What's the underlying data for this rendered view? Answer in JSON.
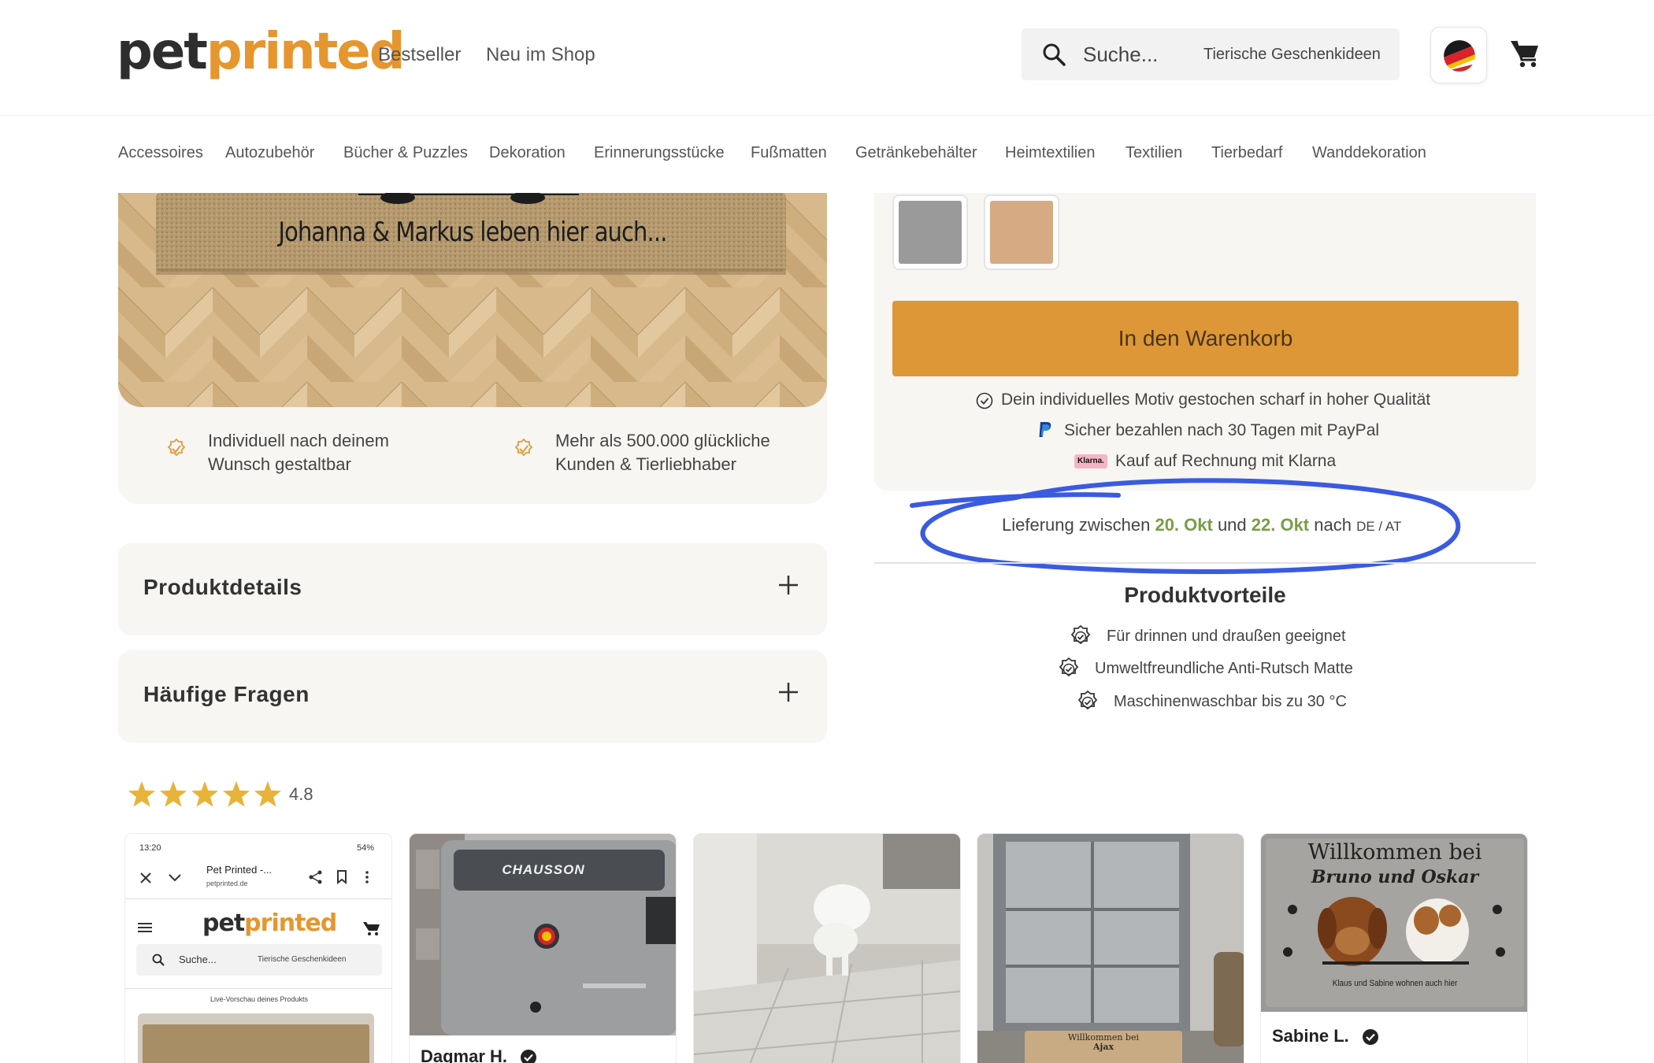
{
  "header": {
    "logo_part1": "pet",
    "logo_part2": "printed",
    "nav": [
      "Bestseller",
      "Neu im Shop"
    ],
    "search": {
      "placeholder": "Suche...",
      "hint": "Tierische Geschenkideen"
    },
    "flag_icon": "germany-austria-flag-icon",
    "cart_icon": "shopping-cart-icon"
  },
  "categories": [
    "Accessoires",
    "Autozubehör",
    "Bücher & Puzzles",
    "Dekoration",
    "Erinnerungsstücke",
    "Fußmatten",
    "Getränkebehälter",
    "Heimtextilien",
    "Textilien",
    "Tierbedarf",
    "Wanddekoration"
  ],
  "product": {
    "mat_text": "Johanna & Markus leben hier auch...",
    "benefits": [
      {
        "line1": "Individuell nach deinem",
        "line2": "Wunsch gestaltbar"
      },
      {
        "line1": "Mehr als 500.000 glückliche",
        "line2": "Kunden & Tierliebhaber"
      }
    ],
    "accordions": [
      "Produktdetails",
      "Häufige Fragen"
    ]
  },
  "purchase": {
    "swatches": [
      {
        "name": "grau",
        "color": "#9a9a9a"
      },
      {
        "name": "natur",
        "color": "#d6aa82"
      }
    ],
    "cart_button": "In den Warenkorb",
    "trust": [
      {
        "icon": "check-circle-icon",
        "text": "Dein individuelles Motiv gestochen scharf in hoher Qualität"
      },
      {
        "icon": "paypal-icon",
        "text": "Sicher bezahlen nach 30 Tagen mit PayPal"
      },
      {
        "icon": "klarna-icon",
        "badge": "Klarna.",
        "text": "Kauf auf Rechnung mit Klarna"
      }
    ],
    "delivery": {
      "prefix": "Lieferung zwischen ",
      "date1": "20. Okt",
      "middle": " und ",
      "date2": "22. Okt",
      "suffix": " nach ",
      "region": "DE / AT"
    }
  },
  "vorteile": {
    "title": "Produktvorteile",
    "items": [
      "Für drinnen und draußen geeignet",
      "Umweltfreundliche Anti-Rutsch Matte",
      "Maschinenwaschbar bis zu 30 °C"
    ]
  },
  "reviews": {
    "rating": "4.8",
    "star_count": 5,
    "accent": "#e8b33b",
    "cards": [
      {
        "type": "phone-screenshot",
        "time": "13:20",
        "battery": "54%",
        "site_title": "Pet Printed -...",
        "site_url": "petprinted.de",
        "logo_part1": "pet",
        "logo_part2": "printed",
        "search": "Suche...",
        "search_hint": "Tierische Geschenkideen",
        "preview_label": "Live-Vorschau deines Produkts",
        "name": ""
      },
      {
        "type": "van",
        "brand": "CHAUSSON",
        "name": "Dagmar H."
      },
      {
        "type": "dog-floor",
        "name": ""
      },
      {
        "type": "door-mat",
        "mat_line1": "Willkommen bei",
        "mat_line2": "Ajax",
        "name": ""
      },
      {
        "type": "mat",
        "mat_line1": "Willkommen bei",
        "mat_line2": "Bruno und Oskar",
        "mat_line3": "Klaus und Sabine wohnen auch hier",
        "name": "Sabine L."
      }
    ]
  }
}
